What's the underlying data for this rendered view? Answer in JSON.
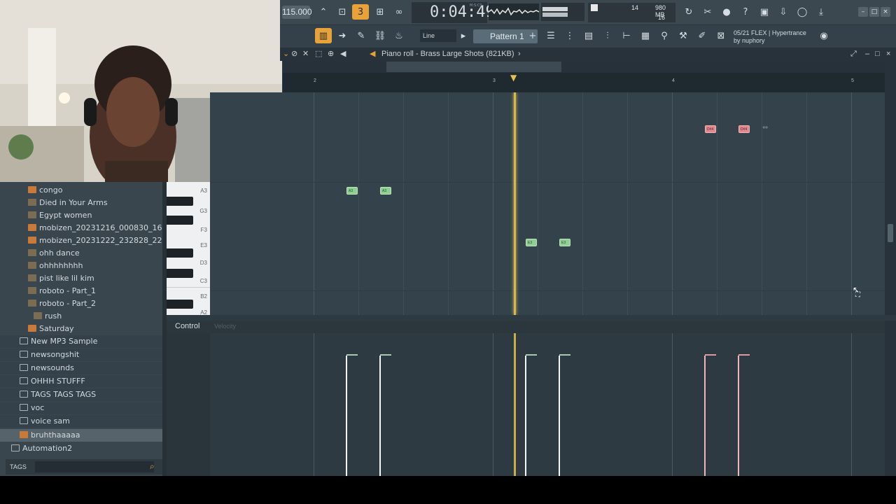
{
  "toolbar": {
    "tempo": "115.000",
    "time": "0:04:49",
    "time_unit": "M:S:CS",
    "mem_top": "14",
    "mem_mb": "980 MB",
    "mem_bottom": "16",
    "snap": "Line",
    "pattern": "Pattern 1",
    "news_line1": "05/21  FLEX | Hypertrance",
    "news_line2": "by nuphory",
    "accent": "#e8a23a"
  },
  "piano_roll": {
    "title": "Piano roll - Brass Large Shots (821KB)",
    "ruler": [
      "2",
      "3",
      "4",
      "5"
    ],
    "keys": [
      "A3",
      "G3",
      "F3",
      "E3",
      "D3",
      "C3",
      "B2",
      "A2"
    ],
    "notes": [
      {
        "label": "A3",
        "color": "green"
      },
      {
        "label": "A3",
        "color": "green"
      },
      {
        "label": "E3",
        "color": "green"
      },
      {
        "label": "E3",
        "color": "green"
      },
      {
        "label": "D#4",
        "color": "red"
      },
      {
        "label": "D#4",
        "color": "red"
      }
    ]
  },
  "control": {
    "label": "Control",
    "param": "Velocity"
  },
  "browser": {
    "items": [
      {
        "label": "congo",
        "icon": "audio"
      },
      {
        "label": "Died in Your Arms",
        "icon": "pattern"
      },
      {
        "label": "Egypt women",
        "icon": "pattern"
      },
      {
        "label": "mobizen_20231216_000830_16122023",
        "icon": "audio"
      },
      {
        "label": "mobizen_20231222_232828_22122023",
        "icon": "audio"
      },
      {
        "label": "ohh dance",
        "icon": "pattern"
      },
      {
        "label": "ohhhhhhhh",
        "icon": "pattern"
      },
      {
        "label": "pist like lil kim",
        "icon": "pattern"
      },
      {
        "label": "roboto - Part_1",
        "icon": "pattern"
      },
      {
        "label": "roboto - Part_2",
        "icon": "pattern"
      },
      {
        "label": "rush",
        "icon": "pattern"
      },
      {
        "label": "Saturday",
        "icon": "audio"
      }
    ],
    "folders": [
      {
        "label": "New MP3 Sample"
      },
      {
        "label": "newsongshit"
      },
      {
        "label": "newsounds"
      },
      {
        "label": "OHHH STUFFF"
      },
      {
        "label": "TAGS TAGS TAGS"
      },
      {
        "label": "voc"
      },
      {
        "label": "voice sam"
      }
    ],
    "selected": "bruhthaaaaa",
    "automation": "Automation2",
    "tags_label": "TAGS"
  }
}
